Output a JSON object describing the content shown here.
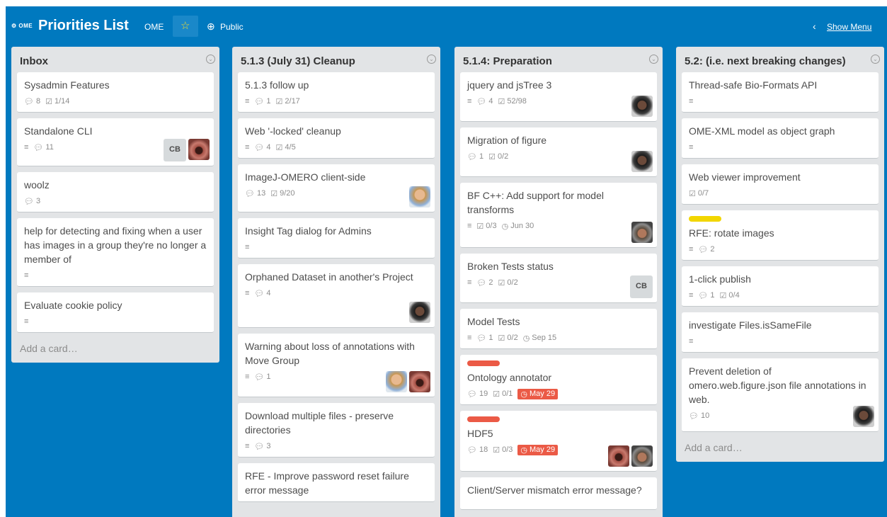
{
  "header": {
    "logo_text": "OME",
    "board_title": "Priorities List",
    "org": "OME",
    "star_icon": "star-icon",
    "visibility": "Public",
    "show_menu": "Show Menu"
  },
  "colors": {
    "board_bg": "#0079bf",
    "label_red": "#eb5a46",
    "label_yellow": "#f2d600",
    "due_red": "#eb5a46"
  },
  "lists": [
    {
      "title": "Inbox",
      "add_card": "Add a card…",
      "cards": [
        {
          "title": "Sysadmin Features",
          "comments": "8",
          "checklist": "1/14"
        },
        {
          "title": "Standalone CLI",
          "comments": "11",
          "initials": "CB"
        },
        {
          "title": "woolz",
          "comments": "3"
        },
        {
          "title": "help for detecting and fixing when a user has images in a group they're no longer a member of"
        },
        {
          "title": "Evaluate cookie policy"
        }
      ]
    },
    {
      "title": "5.1.3 (July 31) Cleanup",
      "cards": [
        {
          "title": "5.1.3 follow up",
          "comments": "1",
          "checklist": "2/17"
        },
        {
          "title": "Web '-locked' cleanup",
          "comments": "4",
          "checklist": "4/5"
        },
        {
          "title": "ImageJ-OMERO client-side",
          "comments": "13",
          "checklist": "9/20"
        },
        {
          "title": "Insight Tag dialog for Admins"
        },
        {
          "title": "Orphaned Dataset in another's Project",
          "comments": "4"
        },
        {
          "title": "Warning about loss of annotations with Move Group",
          "comments": "1"
        },
        {
          "title": "Download multiple files - preserve directories",
          "comments": "3"
        },
        {
          "title": "RFE - Improve password reset failure error message"
        }
      ]
    },
    {
      "title": "5.1.4: Preparation",
      "cards": [
        {
          "title": "jquery and jsTree 3",
          "comments": "4",
          "checklist": "52/98"
        },
        {
          "title": "Migration of figure",
          "comments": "1",
          "checklist": "0/2"
        },
        {
          "title": "BF C++: Add support for model transforms",
          "checklist": "0/3",
          "due": "Jun 30"
        },
        {
          "title": "Broken Tests status",
          "comments": "2",
          "checklist": "0/2",
          "initials": "CB"
        },
        {
          "title": "Model Tests",
          "comments": "1",
          "checklist": "0/2",
          "due": "Sep 15"
        },
        {
          "title": "Ontology annotator",
          "comments": "19",
          "checklist": "0/1",
          "due": "May 29"
        },
        {
          "title": "HDF5",
          "comments": "18",
          "checklist": "0/3",
          "due": "May 29"
        },
        {
          "title": "Client/Server mismatch error message?"
        }
      ]
    },
    {
      "title": "5.2: (i.e. next breaking changes)",
      "add_card": "Add a card…",
      "cards": [
        {
          "title": "Thread-safe Bio-Formats API"
        },
        {
          "title": "OME-XML model as object graph"
        },
        {
          "title": "Web viewer improvement",
          "checklist": "0/7"
        },
        {
          "title": "RFE: rotate images",
          "comments": "2"
        },
        {
          "title": "1-click publish",
          "comments": "1",
          "checklist": "0/4"
        },
        {
          "title": "investigate Files.isSameFile"
        },
        {
          "title": "Prevent deletion of omero.web.figure.json file annotations in web.",
          "comments": "10"
        }
      ]
    }
  ]
}
